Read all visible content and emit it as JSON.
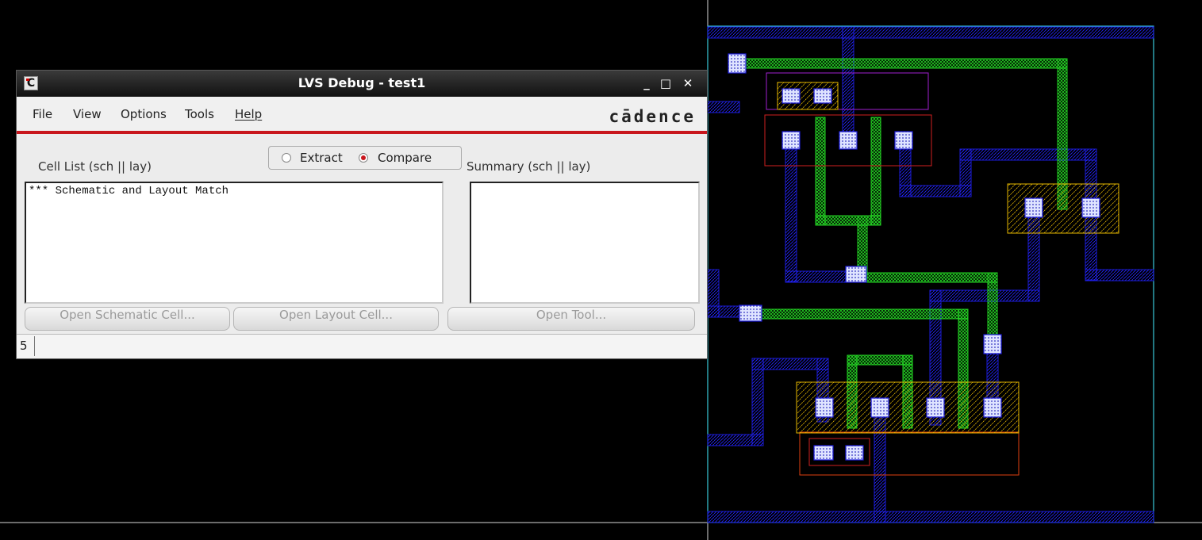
{
  "window": {
    "title": "LVS Debug - test1",
    "minimize": "_",
    "maximize": "□",
    "close": "✕",
    "app_icon": "C"
  },
  "menu": {
    "file": "File",
    "view": "View",
    "options": "Options",
    "tools": "Tools",
    "help": "Help"
  },
  "brand": "cādence",
  "mode": {
    "extract": "Extract",
    "compare": "Compare",
    "selected": "Compare"
  },
  "cell_list": {
    "label": "Cell List (sch || lay)",
    "content": "*** Schematic and Layout Match"
  },
  "summary": {
    "label": "Summary (sch || lay)"
  },
  "buttons": {
    "open_schematic": "Open Schematic Cell...",
    "open_layout": "Open Layout Cell...",
    "open_tool": "Open Tool..."
  },
  "status": {
    "count": "5"
  },
  "colors": {
    "accent": "#c8161d",
    "metal1": "#1b1bd8",
    "poly": "#22d022",
    "diffusion": "#e6b800",
    "boundary": "#38c9d9"
  }
}
